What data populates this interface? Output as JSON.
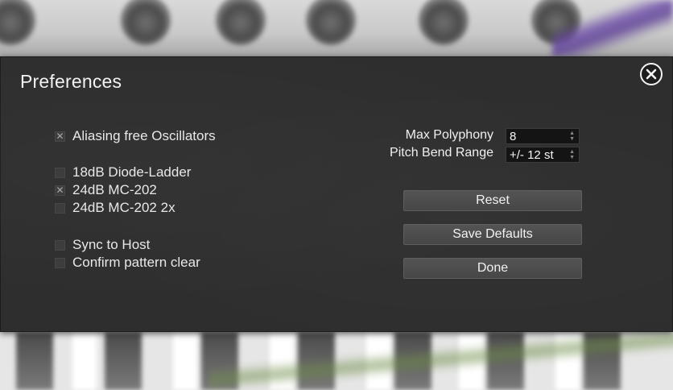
{
  "dialog": {
    "title": "Preferences"
  },
  "options": [
    {
      "label": "Aliasing free Oscillators",
      "checked": true
    },
    {
      "label": "18dB Diode-Ladder",
      "checked": false
    },
    {
      "label": "24dB MC-202",
      "checked": true
    },
    {
      "label": "24dB MC-202 2x",
      "checked": false
    },
    {
      "label": "Sync to Host",
      "checked": false
    },
    {
      "label": "Confirm pattern clear",
      "checked": false
    }
  ],
  "check_mark": "✕",
  "settings": {
    "max_polyphony": {
      "label": "Max Polyphony",
      "value": "8"
    },
    "pitch_bend_range": {
      "label": "Pitch Bend Range",
      "value": "+/- 12 st"
    }
  },
  "buttons": {
    "reset": "Reset",
    "save_defaults": "Save Defaults",
    "done": "Done"
  },
  "colors": {
    "dialog_bg": "#2e2e2e",
    "button_bg": "#4d4d4d",
    "text": "#f2f2f2",
    "accent_purple": "#6b4aa8"
  }
}
